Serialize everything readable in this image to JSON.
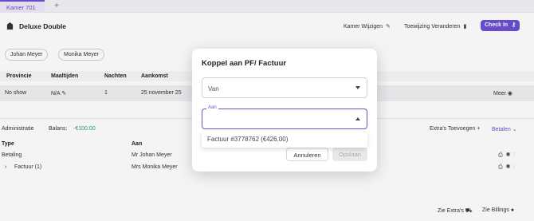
{
  "tabs": {
    "active": "Kamer 701",
    "add": "+"
  },
  "room": {
    "title": "Deluxe Double",
    "change_room": "Kamer Wijzigen",
    "change_assignment": "Toewijzing Veranderen",
    "checkin": "Check In"
  },
  "guests": [
    "Johan Meyer",
    "Monika Meyer"
  ],
  "stay": {
    "headers": {
      "province": "Provincie",
      "meals": "Maaltijden",
      "nights": "Nachten",
      "arrival": "Aankomst"
    },
    "row": {
      "province": "No show",
      "meals": "N/A",
      "nights": "1",
      "arrival": "25 november 25",
      "more": "Meer"
    }
  },
  "admin": {
    "title": "Administratie",
    "balance_label": "Balans:",
    "balance_value": "-€100.00",
    "extras": "Extra's Toevoegen",
    "payments": "Betalen",
    "headers": {
      "type": "Type",
      "to": "Aan"
    },
    "rows": [
      {
        "type": "Betaling",
        "to": "Mr Johan Meyer"
      },
      {
        "type": "Factuur (1)",
        "to": "Mrs Monika Meyer"
      }
    ]
  },
  "footer": {
    "see_extras": "Zie Extra's",
    "see_bills": "Zie Billings"
  },
  "modal": {
    "title": "Koppel aan PF/ Factuur",
    "from_value": "Van",
    "to_label": "Aan",
    "to_value": "",
    "option": "Factuur #3778762 (€426.00)",
    "cancel": "Annuleren",
    "save": "Opslaan"
  },
  "colors": {
    "accent": "#6a4fd1",
    "balance": "#2a9d7a"
  }
}
